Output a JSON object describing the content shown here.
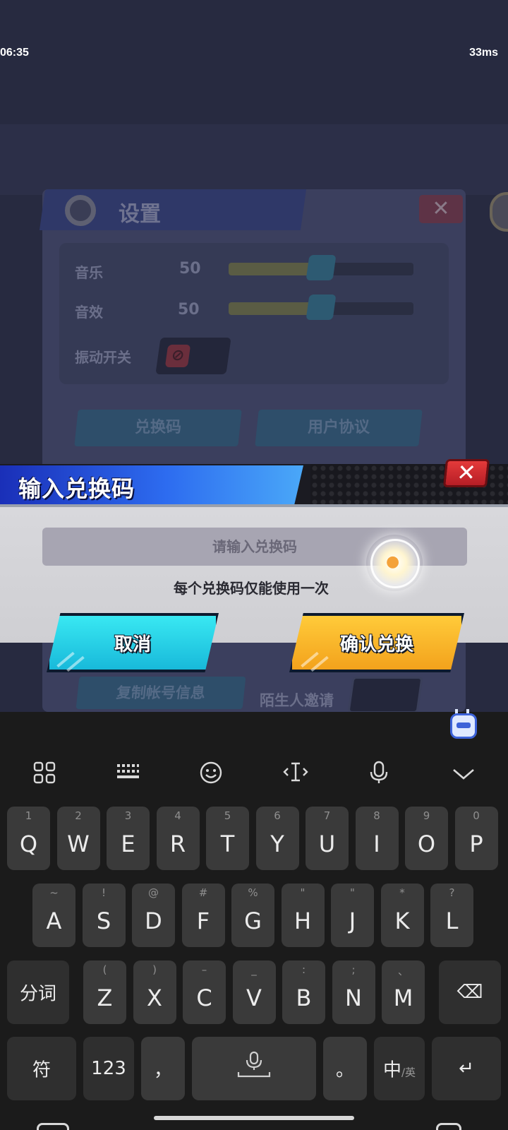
{
  "status_bar": {
    "time": "06:35",
    "latency": "33ms"
  },
  "settings_panel": {
    "title": "设置",
    "close_glyph": "✕",
    "music_label": "音乐",
    "music_value": "50",
    "sound_label": "音效",
    "sound_value": "50",
    "music_level": 0.5,
    "sound_level": 0.5,
    "vibration_label": "振动开关",
    "redeem_button": "兑换码",
    "agreement_button": "用户协议",
    "copy_account_button": "复制帐号信息",
    "stranger_invite_label": "陌生人邀请"
  },
  "redeem_dialog": {
    "title": "输入兑换码",
    "close_glyph": "✕",
    "input_placeholder": "请输入兑换码",
    "input_value": "",
    "note": "每个兑换码仅能使用一次",
    "cancel_label": "取消",
    "confirm_label": "确认兑换",
    "colors": {
      "title_bar": "#2d6cf0",
      "cancel": "#2ad4ea",
      "confirm": "#f8b42a",
      "close": "#d42a30"
    }
  },
  "keyboard": {
    "toolbar_icons": [
      "apps-grid-icon",
      "keyboard-icon",
      "emoji-icon",
      "cursor-icon",
      "microphone-icon",
      "chevron-down-icon"
    ],
    "row1": [
      {
        "key": "Q",
        "hint": "1"
      },
      {
        "key": "W",
        "hint": "2"
      },
      {
        "key": "E",
        "hint": "3"
      },
      {
        "key": "R",
        "hint": "4"
      },
      {
        "key": "T",
        "hint": "5"
      },
      {
        "key": "Y",
        "hint": "6"
      },
      {
        "key": "U",
        "hint": "7"
      },
      {
        "key": "I",
        "hint": "8"
      },
      {
        "key": "O",
        "hint": "9"
      },
      {
        "key": "P",
        "hint": "0"
      }
    ],
    "row2": [
      {
        "key": "A",
        "hint": "~"
      },
      {
        "key": "S",
        "hint": "!"
      },
      {
        "key": "D",
        "hint": "@"
      },
      {
        "key": "F",
        "hint": "#"
      },
      {
        "key": "G",
        "hint": "%"
      },
      {
        "key": "H",
        "hint": "\""
      },
      {
        "key": "J",
        "hint": "\""
      },
      {
        "key": "K",
        "hint": "*"
      },
      {
        "key": "L",
        "hint": "?"
      }
    ],
    "row3": [
      {
        "key": "Z",
        "hint": "("
      },
      {
        "key": "X",
        "hint": ")"
      },
      {
        "key": "C",
        "hint": "–"
      },
      {
        "key": "V",
        "hint": "_"
      },
      {
        "key": "B",
        "hint": ":"
      },
      {
        "key": "N",
        "hint": ";"
      },
      {
        "key": "M",
        "hint": "、"
      }
    ],
    "segment_key": "分词",
    "symbol_key": "符",
    "number_key": "123",
    "comma_key": "，",
    "period_key": "。",
    "lang_key_main": "中",
    "lang_key_sub": "/英",
    "enter_glyph": "↵",
    "backspace_glyph": "⌫"
  }
}
